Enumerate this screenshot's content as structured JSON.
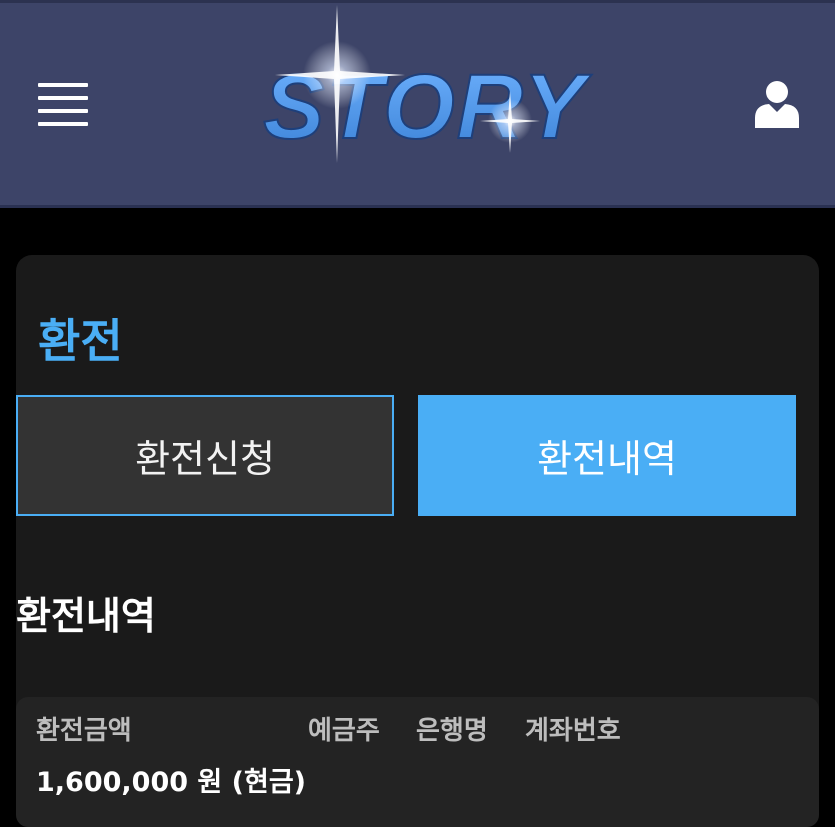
{
  "header": {
    "logo_text": "STORY",
    "menu_icon": "hamburger-icon",
    "user_icon": "user-icon"
  },
  "page": {
    "title": "환전",
    "tabs": [
      {
        "label": "환전신청"
      },
      {
        "label": "환전내역"
      }
    ],
    "section_title": "환전내역"
  },
  "history": {
    "columns": [
      "환전금액",
      "예금주",
      "은행명",
      "계좌번호"
    ],
    "rows": [
      {
        "amount": "1,600,000 원 (현금)"
      }
    ]
  },
  "colors": {
    "header_bg": "#3d4468",
    "accent": "#4aaef5",
    "panel_bg": "#1a1a1a"
  }
}
